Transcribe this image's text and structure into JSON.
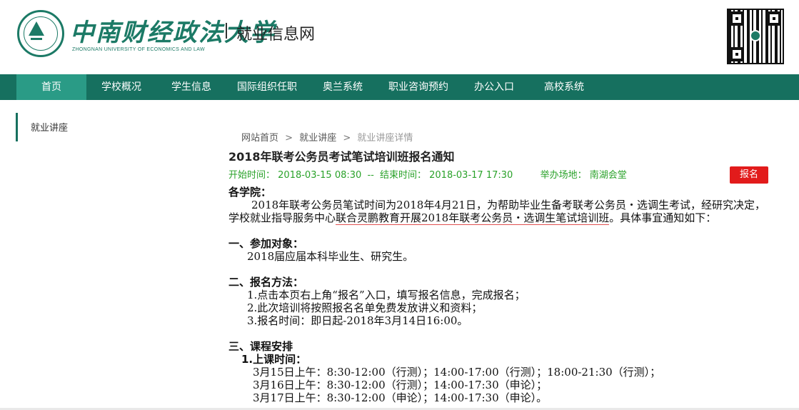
{
  "header": {
    "logo_cn": "中南财经政法大学",
    "logo_en": "ZHONGNAN UNIVERSITY OF ECONOMICS AND LAW",
    "site_title": "就业信息网",
    "brand_color": "#16705f"
  },
  "nav": {
    "items": [
      {
        "label": "首页"
      },
      {
        "label": "学校概况"
      },
      {
        "label": "学生信息"
      },
      {
        "label": "国际组织任职"
      },
      {
        "label": "奥兰系统"
      },
      {
        "label": "职业咨询预约"
      },
      {
        "label": "办公入口"
      },
      {
        "label": "高校系统"
      }
    ]
  },
  "sidebar": {
    "items": [
      {
        "label": "就业讲座"
      }
    ]
  },
  "breadcrumb": {
    "home": "网站首页",
    "section": "就业讲座",
    "current": "就业讲座详情",
    "separator": ">"
  },
  "article": {
    "title": "2018年联考公务员考试笔试培训班报名通知",
    "start_label": "开始时间：",
    "start_time": "2018-03-15 08:30",
    "dash": "--",
    "end_label": "结束时间：",
    "end_time": "2018-03-17 17:30",
    "venue_label": "举办场地：",
    "venue": "南湖会堂",
    "signup_button": "报名",
    "meta_color": "#2aa22a",
    "signup_color": "#e21b1b",
    "salutation": "各学院：",
    "intro_before": "2018年联考公务员笔试时间为2018年4月21日，为帮助毕业生备考联考公务员・选调生考试，经研究决定，学校就业指导服务中心",
    "intro_underlined": "联合灵鹏教育开展2018年联考公务员・选调生笔试培训班",
    "intro_after": "。具体事宜通知如下：",
    "s1_heading": "一、参加对象：",
    "s1_text": "2018届应届本科毕业生、研究生。",
    "s2_heading": "二、报名方法：",
    "s2_items": [
      "1.点击本页右上角“报名”入口，填写报名信息，完成报名；",
      "2.此次培训将按照报名名单免费发放讲义和资料；",
      "3.报名时间：即日起-2018年3月14日16:00。"
    ],
    "s3_heading": "三、课程安排",
    "s3_sub": "1.上课时间：",
    "s3_lines": [
      "3月15日上午：8:30-12:00（行测）；14:00-17:00（行测）；18:00-21:30（行测）；",
      "3月16日上午：8:30-12:00（行测）；14:00-17:30（申论）；",
      "3月17日上午：8:30-12:00（申论）；14:00-17:30（申论）。"
    ]
  }
}
